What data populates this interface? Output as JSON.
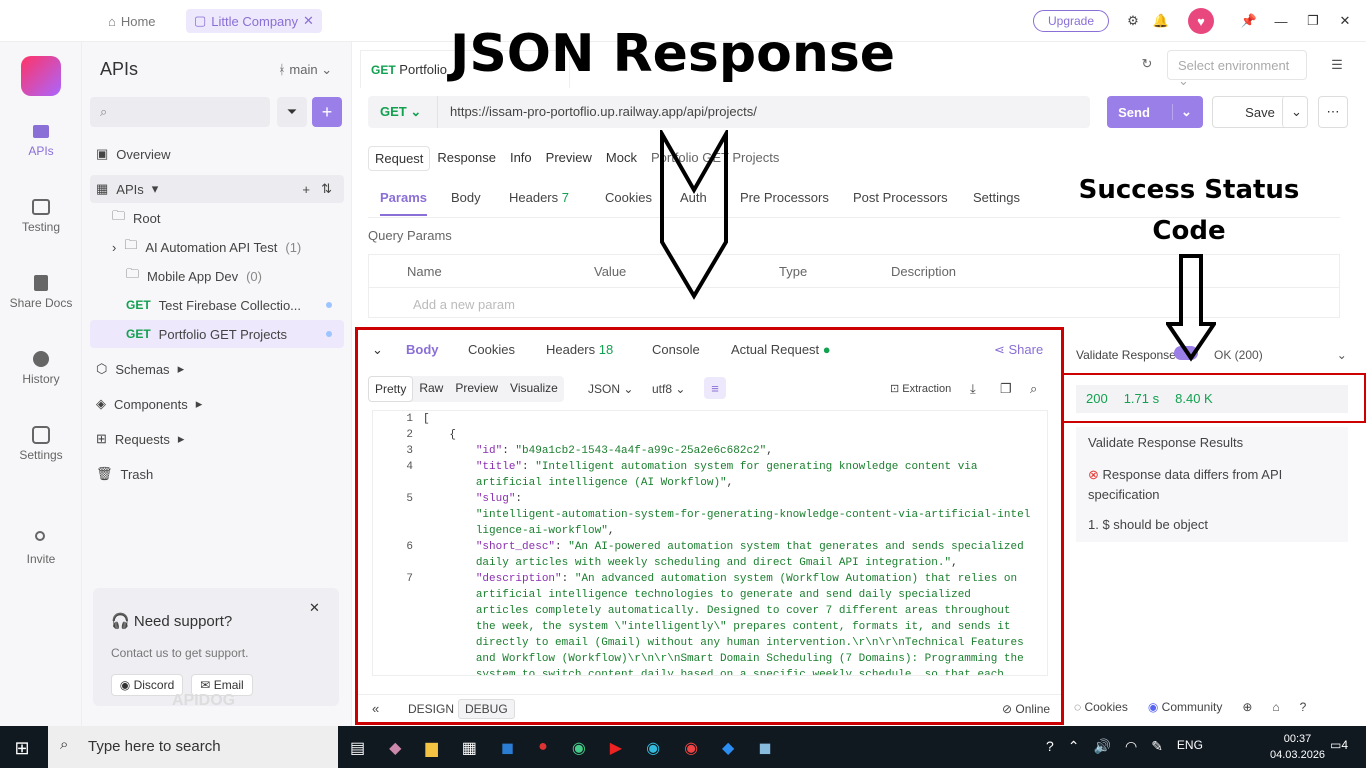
{
  "topbar": {
    "home": "Home",
    "team": "Little Company",
    "upgrade": "Upgrade"
  },
  "rail": {
    "apis": "APIs",
    "testing": "Testing",
    "share_docs": "Share Docs",
    "history": "History",
    "settings": "Settings",
    "invite": "Invite"
  },
  "sidebar": {
    "title": "APIs",
    "branch": "main",
    "overview": "Overview",
    "apis_node": "APIs",
    "root": "Root",
    "folder1": "AI Automation API Test",
    "folder1_count": "(1)",
    "folder2": "Mobile App Dev",
    "folder2_count": "(0)",
    "ep1_method": "GET",
    "ep1": "Test Firebase Collectio...",
    "ep2_method": "GET",
    "ep2": "Portfolio GET Projects",
    "schemas": "Schemas",
    "components": "Components",
    "requests": "Requests",
    "trash": "Trash",
    "support_title": "Need support?",
    "support_text": "Contact us to get support.",
    "discord": "Discord",
    "email": "Email",
    "watermark": "APIDOG"
  },
  "request": {
    "tab_method": "GET",
    "tab_title": "Portfolio",
    "env_placeholder": "Select environment",
    "method": "GET",
    "url": "https://issam-pro-portoflio.up.railway.app/api/projects/",
    "send": "Send",
    "save": "Save",
    "subtabs": [
      "Request",
      "Response",
      "Info",
      "Preview",
      "Mock"
    ],
    "name_label": "Portfolio GET Projects",
    "param_tabs": {
      "params": "Params",
      "body": "Body",
      "headers": "Headers",
      "headers_count": "7",
      "cookies": "Cookies",
      "auth": "Auth",
      "pre": "Pre Processors",
      "post": "Post Processors",
      "settings": "Settings"
    },
    "query_params": "Query Params",
    "cols": [
      "Name",
      "Value",
      "Type",
      "Description"
    ],
    "add_param": "Add a new param"
  },
  "response": {
    "tabs": {
      "body": "Body",
      "cookies": "Cookies",
      "headers": "Headers",
      "headers_count": "18",
      "console": "Console",
      "actual": "Actual Request",
      "share": "Share"
    },
    "views": [
      "Pretty",
      "Raw",
      "Preview",
      "Visualize"
    ],
    "format": "JSON",
    "encoding": "utf8",
    "extraction": "Extraction",
    "status": "200",
    "time": "1.71 s",
    "size": "8.40 K",
    "validate_label": "Validate Response",
    "ok": "OK (200)",
    "results_title": "Validate Response Results",
    "error": "Response data differs from API specification",
    "error_item": "1. $ should be object",
    "design": "DESIGN",
    "debug": "DEBUG",
    "online": "Online",
    "cookies_foot": "Cookies",
    "community": "Community"
  },
  "annotations": {
    "title": "JSON Response",
    "status": "Success Status Code"
  },
  "taskbar": {
    "search": "Type here to search",
    "lang": "ENG",
    "time": "00:37",
    "date": "04.03.2026",
    "notif": "4"
  }
}
